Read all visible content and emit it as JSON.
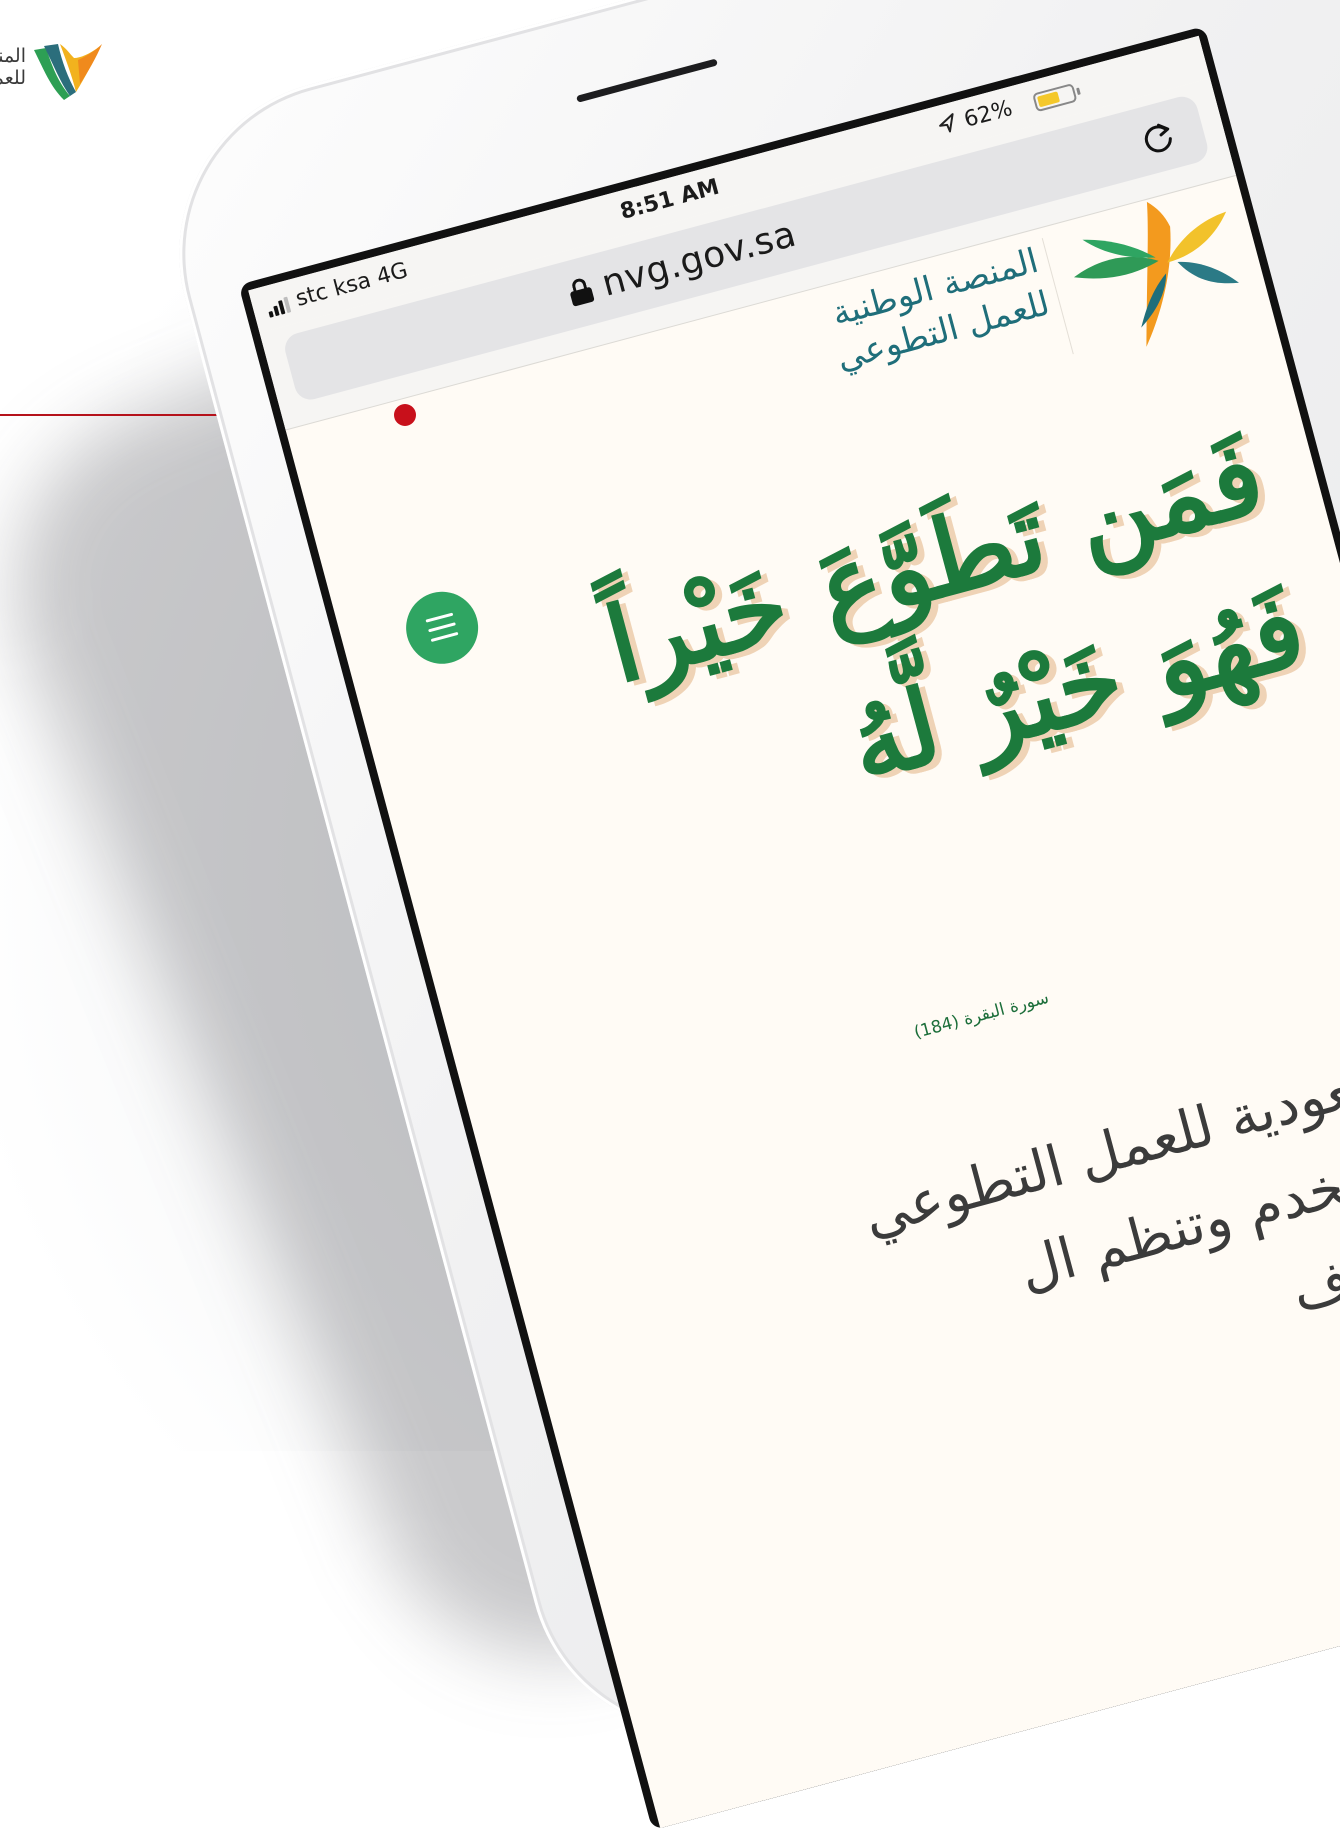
{
  "brand_logo": {
    "line1": "المنصة الوطنية",
    "line2": "للعمل التطوعي",
    "colors": [
      "#f2b21e",
      "#2d9f54",
      "#2b6e7c",
      "#f08a1c"
    ]
  },
  "pointer": {
    "color": "#c8101b"
  },
  "status_bar": {
    "carrier": "stc ksa  4G",
    "time": "8:51 AM",
    "location_icon": "location-arrow-icon",
    "battery_percent": "62%",
    "battery_level": 0.62
  },
  "browser": {
    "url": "nvg.gov.sa",
    "lock_icon": "lock-icon",
    "reload_icon": "reload-icon"
  },
  "site": {
    "title_line1": "المنصة الوطنية",
    "title_line2": "للعمل التطوعي",
    "menu_icon": "hamburger-menu-icon",
    "accent": "#2fa562",
    "title_color": "#1f6e7a"
  },
  "hero": {
    "verse_line1": "فَمَن تَطَوَّعَ خَيْراً",
    "verse_line2": "فَهُوَ خَيْرٌ لَّهُ",
    "reference": "سورة البقرة (184)",
    "verse_color": "#1c7a3c",
    "shadow_color": "#efd3b6"
  },
  "intro": {
    "line1": "منصة سعودية للعمل التطوعي",
    "line2": "بيئة آمنة تخدم وتنظم ال",
    "line3": "جهات الموف"
  }
}
